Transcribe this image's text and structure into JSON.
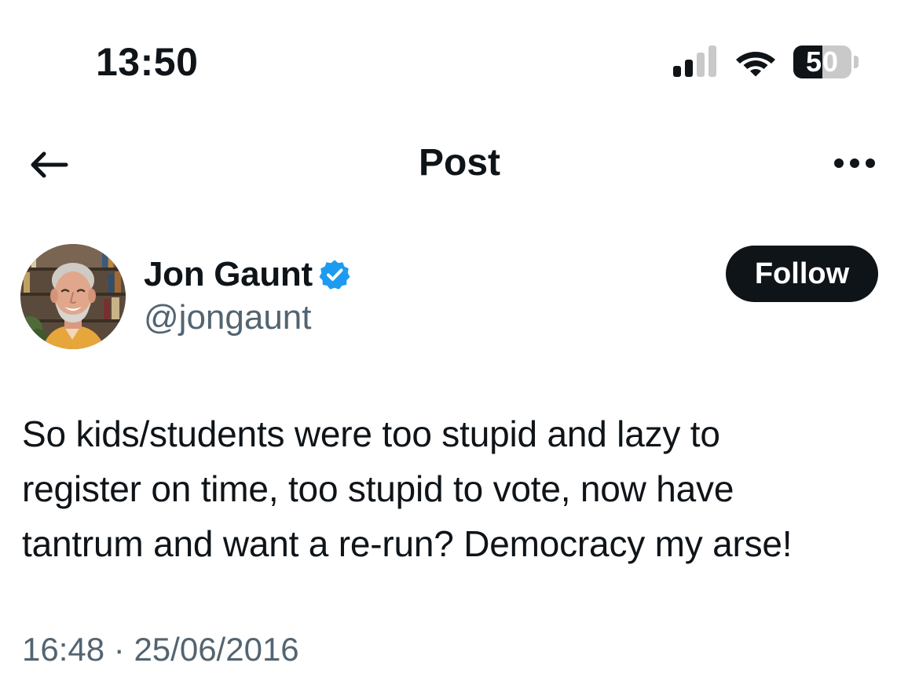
{
  "status_bar": {
    "time": "13:50",
    "battery_level": "50",
    "battery_fraction": 0.5,
    "icons": [
      "signal-icon",
      "wifi-icon",
      "battery-icon"
    ]
  },
  "header": {
    "title": "Post",
    "back_icon": "arrow-left-icon",
    "more_icon": "more-horizontal-icon"
  },
  "post": {
    "author": {
      "name": "Jon Gaunt",
      "handle": "@jongaunt",
      "verified": true,
      "verified_color": "#1d9bf0"
    },
    "follow_label": "Follow",
    "text": "So kids/students were too stupid and lazy to\nregister on time, too stupid to vote, now have\ntantrum and want a re-run? Democracy my arse!",
    "time": "16:48",
    "date": "25/06/2016",
    "separator": "·"
  },
  "colors": {
    "text_primary": "#0f1419",
    "text_secondary": "#536471",
    "button_dark": "#0f1419",
    "verified_blue": "#1d9bf0"
  }
}
